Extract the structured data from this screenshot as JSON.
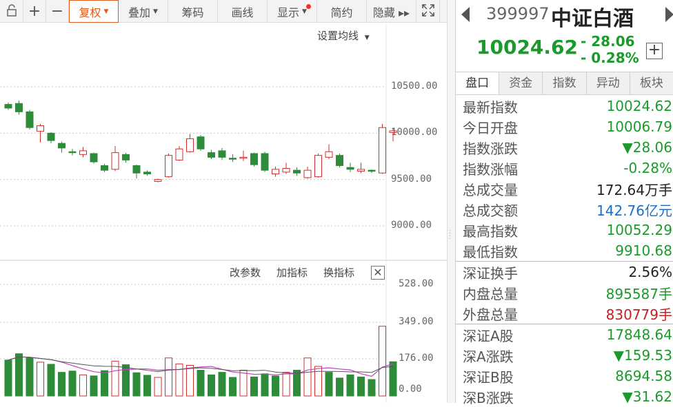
{
  "toolbar": {
    "items": [
      {
        "label": "",
        "icon": "unlock-icon"
      },
      {
        "label": "+",
        "icon": "zoom-in-icon"
      },
      {
        "label": "−",
        "icon": "zoom-out-icon"
      },
      {
        "label": "复权",
        "caret": true,
        "active": true
      },
      {
        "label": "叠加",
        "caret": true
      },
      {
        "label": "筹码"
      },
      {
        "label": "画线"
      },
      {
        "label": "显示",
        "caret": true,
        "dot": true
      },
      {
        "label": "简约"
      },
      {
        "label": "隐藏 ▸▸"
      },
      {
        "label": "",
        "icon": "fullscreen-icon"
      }
    ]
  },
  "chart": {
    "ma_setting_label": "设置均线",
    "price_axis": [
      "10500.00",
      "10000.00",
      "9500.00",
      "9000.00"
    ],
    "indicator_buttons": [
      "改参数",
      "加指标",
      "换指标"
    ],
    "volume_axis": [
      "528.00",
      "349.00",
      "176.00",
      "0.00"
    ]
  },
  "chart_data": {
    "type": "candlestick",
    "candles": [
      {
        "o": 10310,
        "c": 10270,
        "h": 10330,
        "l": 10250
      },
      {
        "o": 10320,
        "c": 10230,
        "h": 10350,
        "l": 10200
      },
      {
        "o": 10230,
        "c": 10060,
        "h": 10250,
        "l": 10040
      },
      {
        "o": 10020,
        "c": 10080,
        "h": 10100,
        "l": 9900
      },
      {
        "o": 10000,
        "c": 9920,
        "h": 10010,
        "l": 9890
      },
      {
        "o": 9890,
        "c": 9840,
        "h": 9910,
        "l": 9790
      },
      {
        "o": 9800,
        "c": 9790,
        "h": 9830,
        "l": 9760
      },
      {
        "o": 9770,
        "c": 9810,
        "h": 9850,
        "l": 9740
      },
      {
        "o": 9780,
        "c": 9690,
        "h": 9790,
        "l": 9670
      },
      {
        "o": 9650,
        "c": 9600,
        "h": 9670,
        "l": 9580
      },
      {
        "o": 9610,
        "c": 9790,
        "h": 9860,
        "l": 9590
      },
      {
        "o": 9770,
        "c": 9710,
        "h": 9790,
        "l": 9680
      },
      {
        "o": 9650,
        "c": 9570,
        "h": 9660,
        "l": 9510
      },
      {
        "o": 9580,
        "c": 9560,
        "h": 9600,
        "l": 9540
      },
      {
        "o": 9480,
        "c": 9500,
        "h": 9510,
        "l": 9470
      },
      {
        "o": 9530,
        "c": 9760,
        "h": 9780,
        "l": 9520
      },
      {
        "o": 9710,
        "c": 9830,
        "h": 9860,
        "l": 9700
      },
      {
        "o": 9800,
        "c": 9940,
        "h": 9990,
        "l": 9790
      },
      {
        "o": 9960,
        "c": 9830,
        "h": 9980,
        "l": 9810
      },
      {
        "o": 9790,
        "c": 9740,
        "h": 9820,
        "l": 9720
      },
      {
        "o": 9810,
        "c": 9740,
        "h": 9840,
        "l": 9710
      },
      {
        "o": 9730,
        "c": 9720,
        "h": 9770,
        "l": 9690
      },
      {
        "o": 9730,
        "c": 9740,
        "h": 9810,
        "l": 9700
      },
      {
        "o": 9780,
        "c": 9660,
        "h": 9790,
        "l": 9640
      },
      {
        "o": 9780,
        "c": 9600,
        "h": 9800,
        "l": 9580
      },
      {
        "o": 9560,
        "c": 9610,
        "h": 9640,
        "l": 9530
      },
      {
        "o": 9580,
        "c": 9620,
        "h": 9680,
        "l": 9560
      },
      {
        "o": 9600,
        "c": 9570,
        "h": 9630,
        "l": 9540
      },
      {
        "o": 9520,
        "c": 9600,
        "h": 9640,
        "l": 9510
      },
      {
        "o": 9530,
        "c": 9760,
        "h": 9780,
        "l": 9520
      },
      {
        "o": 9740,
        "c": 9800,
        "h": 9880,
        "l": 9720
      },
      {
        "o": 9760,
        "c": 9650,
        "h": 9780,
        "l": 9630
      },
      {
        "o": 9630,
        "c": 9610,
        "h": 9680,
        "l": 9580
      },
      {
        "o": 9590,
        "c": 9610,
        "h": 9680,
        "l": 9570
      },
      {
        "o": 9600,
        "c": 9590,
        "h": 9610,
        "l": 9570
      },
      {
        "o": 9570,
        "c": 10060,
        "h": 10100,
        "l": 9560
      },
      {
        "o": 10006.79,
        "c": 10024.62,
        "h": 10052.29,
        "l": 9910.68
      }
    ],
    "volumes": [
      {
        "v": 170,
        "up": false
      },
      {
        "v": 200,
        "up": false
      },
      {
        "v": 180,
        "up": false
      },
      {
        "v": 160,
        "up": true
      },
      {
        "v": 150,
        "up": false
      },
      {
        "v": 112,
        "up": false
      },
      {
        "v": 118,
        "up": false
      },
      {
        "v": 100,
        "up": true
      },
      {
        "v": 95,
        "up": false
      },
      {
        "v": 120,
        "up": false
      },
      {
        "v": 165,
        "up": true
      },
      {
        "v": 148,
        "up": false
      },
      {
        "v": 110,
        "up": false
      },
      {
        "v": 98,
        "up": false
      },
      {
        "v": 88,
        "up": true
      },
      {
        "v": 180,
        "up": true
      },
      {
        "v": 152,
        "up": true
      },
      {
        "v": 145,
        "up": true
      },
      {
        "v": 122,
        "up": false
      },
      {
        "v": 100,
        "up": false
      },
      {
        "v": 112,
        "up": false
      },
      {
        "v": 88,
        "up": false
      },
      {
        "v": 122,
        "up": true
      },
      {
        "v": 90,
        "up": false
      },
      {
        "v": 105,
        "up": false
      },
      {
        "v": 95,
        "up": false
      },
      {
        "v": 112,
        "up": true
      },
      {
        "v": 122,
        "up": false
      },
      {
        "v": 180,
        "up": true
      },
      {
        "v": 140,
        "up": true
      },
      {
        "v": 112,
        "up": false
      },
      {
        "v": 85,
        "up": false
      },
      {
        "v": 100,
        "up": false
      },
      {
        "v": 90,
        "up": false
      },
      {
        "v": 78,
        "up": false
      },
      {
        "v": 330,
        "up": true
      },
      {
        "v": 162,
        "up": false
      }
    ],
    "price_range": [
      8700,
      10700
    ],
    "volume_range": [
      0,
      528
    ]
  },
  "quote": {
    "code": "399997",
    "name": "中证白酒",
    "price": "10024.62",
    "change": "- 28.06",
    "change_pct": "- 0.28%",
    "tabs": [
      "盘口",
      "资金",
      "指数",
      "异动",
      "板块"
    ],
    "rows": [
      {
        "k": "最新指数",
        "v": "10024.62",
        "c": "g"
      },
      {
        "k": "今日开盘",
        "v": "10006.79",
        "c": "g"
      },
      {
        "k": "指数涨跌",
        "v": "▼28.06",
        "c": "g"
      },
      {
        "k": "指数涨幅",
        "v": "-0.28%",
        "c": "g"
      },
      {
        "k": "总成交量",
        "v": "172.64万手",
        "c": "d"
      },
      {
        "k": "总成交额",
        "v": "142.76亿元",
        "c": "b"
      },
      {
        "k": "最高指数",
        "v": "10052.29",
        "c": "g"
      },
      {
        "k": "最低指数",
        "v": "9910.68",
        "c": "g"
      },
      {
        "k": "深证换手",
        "v": "2.56%",
        "c": "d"
      },
      {
        "k": "内盘总量",
        "v": "895587手",
        "c": "g"
      },
      {
        "k": "外盘总量",
        "v": "830779手",
        "c": "r"
      },
      {
        "k": "深证A股",
        "v": "17848.64",
        "c": "g"
      },
      {
        "k": "深A涨跌",
        "v": "▼159.53",
        "c": "g"
      },
      {
        "k": "深证B股",
        "v": "8694.58",
        "c": "g"
      },
      {
        "k": "深B涨跌",
        "v": "▼31.62",
        "c": "g"
      }
    ]
  }
}
